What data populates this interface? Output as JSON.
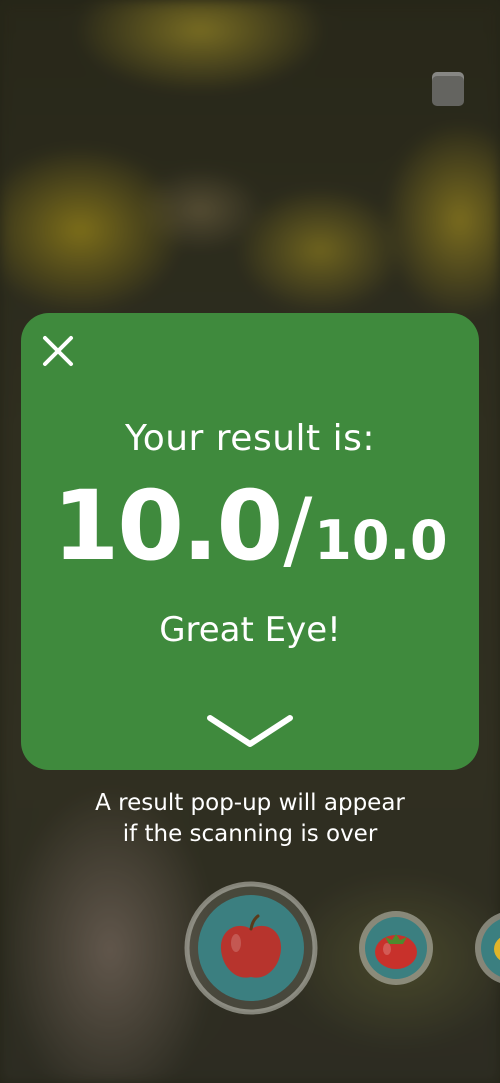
{
  "background": {
    "description_icon": "blurred-camera-view"
  },
  "toolbar": {
    "book_icon": "book-icon"
  },
  "result_popup": {
    "close_icon": "close-icon",
    "label": "Your result is:",
    "score": "10.0",
    "slash": "/",
    "total": "10.0",
    "verdict": "Great Eye!",
    "expand_icon": "chevron-down-icon",
    "card_color": "#3f8a3d"
  },
  "hint": {
    "line1": "A result pop-up will appear",
    "line2": "if the scanning is over"
  },
  "fruit_selector": {
    "items": [
      {
        "icon": "apple-icon",
        "selected": true
      },
      {
        "icon": "tomato-icon",
        "selected": false
      },
      {
        "icon": "lemon-icon",
        "selected": false
      }
    ],
    "accent": "#3b7f80"
  }
}
